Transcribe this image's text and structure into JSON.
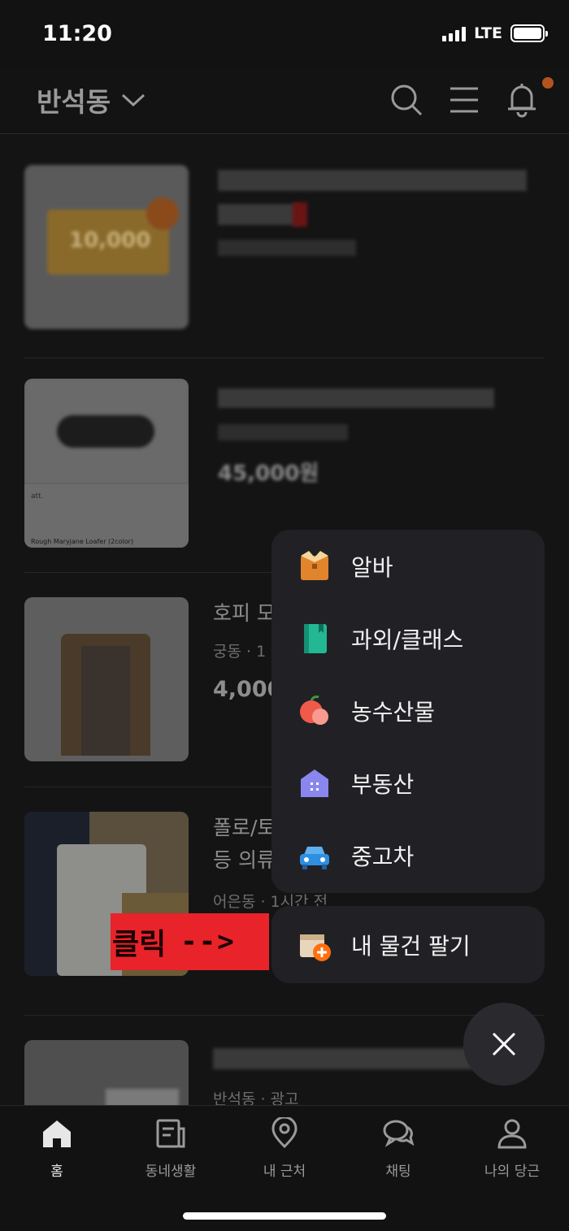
{
  "status_bar": {
    "time": "11:20",
    "network": "LTE"
  },
  "header": {
    "location": "반석동",
    "icons": [
      "chevron-down-icon",
      "search-icon",
      "menu-icon",
      "bell-icon"
    ]
  },
  "feed": {
    "items": [
      {
        "title": "",
        "meta": "",
        "price": "",
        "thumb_text": "10,000"
      },
      {
        "title": "",
        "meta": "",
        "price": "45,000원",
        "thumb_brand": "att.",
        "thumb_caption": "Rough Maryjane Loafer (2color)"
      },
      {
        "title": "호피 모",
        "meta": "궁동 · 1",
        "price": "4,000"
      },
      {
        "title": "폴로/토",
        "title2": "등 의류",
        "meta": "어은동 · 1시간 전",
        "price": ""
      },
      {
        "title": "",
        "meta": "반석동 · 광고",
        "price": ""
      }
    ]
  },
  "menu": {
    "items": [
      {
        "label": "알바",
        "icon": "part-time-job-icon"
      },
      {
        "label": "과외/클래스",
        "icon": "book-icon"
      },
      {
        "label": "농수산물",
        "icon": "apple-icon"
      },
      {
        "label": "부동산",
        "icon": "house-icon"
      },
      {
        "label": "중고차",
        "icon": "car-icon"
      }
    ],
    "sell_label": "내 물건 팔기",
    "sell_icon": "box-plus-icon"
  },
  "annotation": {
    "text": "클릭",
    "arrow": "-->"
  },
  "bottom_nav": {
    "items": [
      {
        "label": "홈",
        "icon": "home-icon"
      },
      {
        "label": "동네생활",
        "icon": "community-icon"
      },
      {
        "label": "내 근처",
        "icon": "location-pin-icon"
      },
      {
        "label": "채팅",
        "icon": "chat-icon"
      },
      {
        "label": "나의 당근",
        "icon": "profile-icon"
      }
    ]
  },
  "colors": {
    "accent": "#ff6f0f",
    "overlay_panel": "#212125",
    "annotation": "#e8232a"
  }
}
